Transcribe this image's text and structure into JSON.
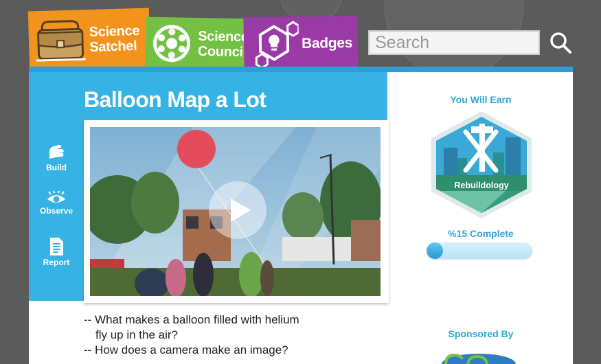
{
  "colors": {
    "satchel_tab": "#f2931d",
    "council_tab": "#73c043",
    "badges_tab": "#9a3aa6",
    "accent_blue": "#36b3e4",
    "label_blue": "#2ea6d9"
  },
  "nav": {
    "tabs": [
      {
        "label_line1": "Science",
        "label_line2": "Satchel",
        "icon": "satchel-icon"
      },
      {
        "label_line1": "Science",
        "label_line2": "Council",
        "icon": "council-icon"
      },
      {
        "label": "Badges",
        "icon": "badges-icon"
      }
    ]
  },
  "search": {
    "placeholder": "Search",
    "value": "",
    "icon": "search-icon"
  },
  "sidebar": {
    "items": [
      {
        "label": "Build",
        "icon": "hands-icon"
      },
      {
        "label": "Observe",
        "icon": "eye-icon"
      },
      {
        "label": "Report",
        "icon": "document-icon"
      }
    ]
  },
  "main": {
    "title": "Balloon Map a Lot",
    "video": {
      "play_icon": "play-icon"
    },
    "questions": [
      "-- What makes a balloon filled with helium",
      "fly up in the air?",
      "-- How does a camera make an image?"
    ]
  },
  "reward": {
    "earn_label": "You Will Earn",
    "badge_name": "Rebuildology",
    "complete_label": "%15 Complete",
    "progress_fraction": 0.15,
    "sponsor_label": "Sponsored By"
  }
}
